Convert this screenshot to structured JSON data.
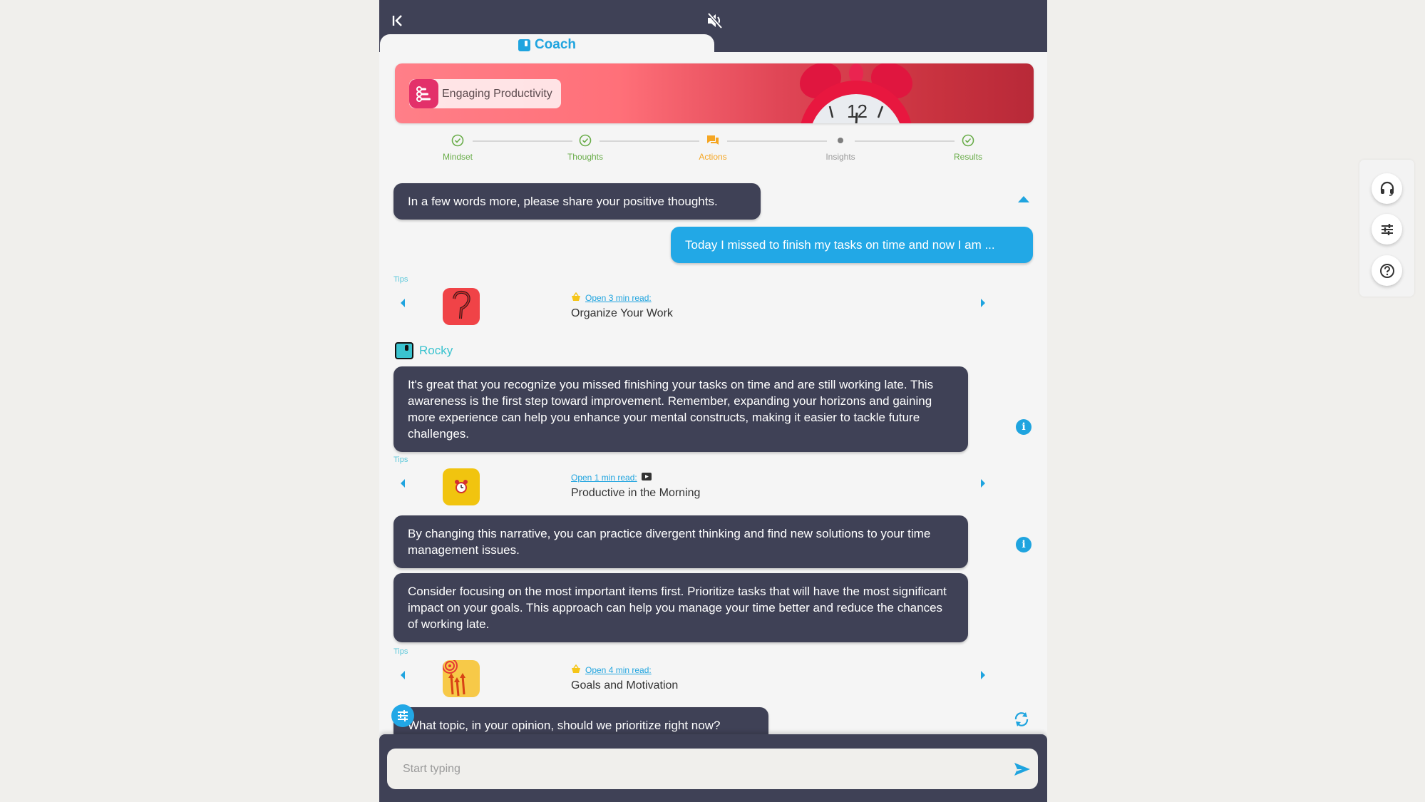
{
  "header": {
    "back_icon": "collapse-left-icon",
    "mute_icon": "volume-muted-icon",
    "tab_label": "Coach"
  },
  "banner": {
    "title": "Engaging Productivity",
    "icon": "bars-list-icon"
  },
  "stepper": {
    "steps": [
      {
        "label": "Mindset",
        "state": "done"
      },
      {
        "label": "Thoughts",
        "state": "done"
      },
      {
        "label": "Actions",
        "state": "active"
      },
      {
        "label": "Insights",
        "state": "pending"
      },
      {
        "label": "Results",
        "state": "done"
      }
    ]
  },
  "chat": {
    "messages": [
      {
        "role": "coach",
        "text": "In a few words more, please share your positive thoughts."
      },
      {
        "role": "user",
        "text": "Today I missed to finish my tasks on time and now I am ..."
      },
      {
        "role": "coach",
        "text": "It's great that you recognize you missed finishing your tasks on time and are still working late. This awareness is the first step toward improvement. Remember, expanding your horizons and gaining more experience can help you enhance your mental constructs, making it easier to tackle future challenges."
      },
      {
        "role": "coach",
        "text": "By changing this narrative, you can practice divergent thinking and find new solutions to your time management issues."
      },
      {
        "role": "coach",
        "text": "Consider focusing on the most important items first. Prioritize tasks that will have the most significant impact on your goals. This approach can help you manage your time better and reduce the chances of working late."
      },
      {
        "role": "coach",
        "text": "What topic, in your opinion, should we prioritize right now?"
      }
    ],
    "coach_name": "Rocky",
    "tips": [
      {
        "label": "Tips",
        "link": "Open 3 min read:",
        "title": "Organize Your Work",
        "premium": true,
        "video": false,
        "thumb_icon": "question-mark-icon"
      },
      {
        "label": "Tips",
        "link": "Open 1 min read:",
        "title": "Productive in the Morning",
        "premium": false,
        "video": true,
        "thumb_icon": "alarm-clock-icon"
      },
      {
        "label": "Tips",
        "link": "Open 4 min read:",
        "title": "Goals and Motivation",
        "premium": true,
        "video": false,
        "thumb_icon": "target-arrows-icon"
      }
    ]
  },
  "input": {
    "placeholder": "Start typing",
    "value": ""
  },
  "side_panel": {
    "buttons": [
      {
        "name": "support",
        "icon": "headset-icon"
      },
      {
        "name": "settings",
        "icon": "sliders-icon"
      },
      {
        "name": "help",
        "icon": "question-circle-icon"
      }
    ]
  },
  "colors": {
    "header_bg": "#3f4156",
    "accent": "#1fa4df",
    "user_bubble": "#22a8e6",
    "coach_bubble": "#3f4156",
    "done": "#6aad4a",
    "active": "#f5a623"
  }
}
